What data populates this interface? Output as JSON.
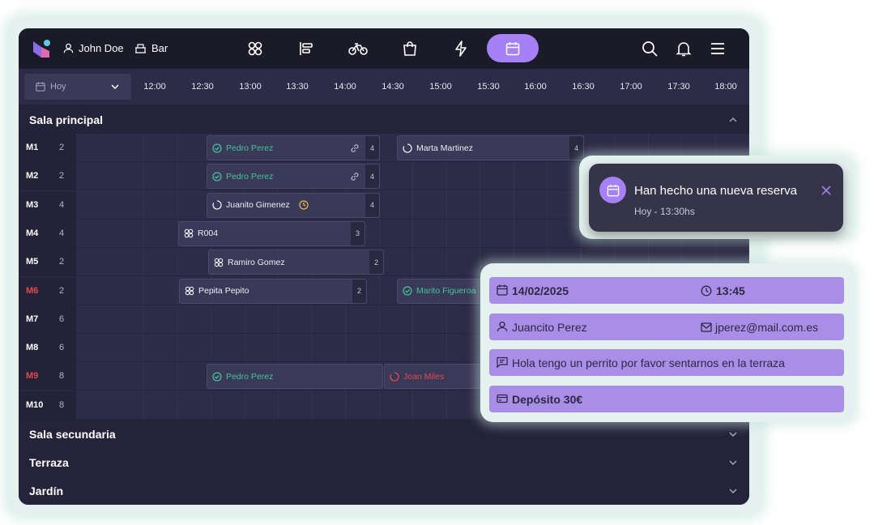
{
  "topbar": {
    "user_name": "John Doe",
    "venue_name": "Bar",
    "nav_icons": [
      "grid-icon",
      "floor-layout-icon",
      "bike-icon",
      "bag-icon",
      "lightning-icon",
      "calendar-icon"
    ],
    "active_nav": "calendar-icon",
    "right_icons": [
      "search-icon",
      "bell-icon",
      "menu-icon"
    ]
  },
  "timeline": {
    "date_selector": "Hoy",
    "times": [
      "12:00",
      "12:30",
      "13:00",
      "13:30",
      "14:00",
      "14:30",
      "15:00",
      "15:30",
      "16:00",
      "16:30",
      "17:00",
      "17:30",
      "18:00"
    ]
  },
  "sections": {
    "main": "Sala principal",
    "secondary": "Sala secundaria",
    "terrace": "Terraza",
    "garden": "Jardín"
  },
  "tables": [
    {
      "name": "M1",
      "capacity": "2",
      "alert": false
    },
    {
      "name": "M2",
      "capacity": "2",
      "alert": false
    },
    {
      "name": "M3",
      "capacity": "4",
      "alert": false
    },
    {
      "name": "M4",
      "capacity": "4",
      "alert": false
    },
    {
      "name": "M5",
      "capacity": "2",
      "alert": false
    },
    {
      "name": "M6",
      "capacity": "2",
      "alert": true
    },
    {
      "name": "M7",
      "capacity": "6",
      "alert": false
    },
    {
      "name": "M8",
      "capacity": "6",
      "alert": false
    },
    {
      "name": "M9",
      "capacity": "8",
      "alert": true
    },
    {
      "name": "M10",
      "capacity": "8",
      "alert": false
    }
  ],
  "reservations": [
    {
      "guest": "Pedro Perez",
      "count": "4",
      "status": "confirmed",
      "linked": true
    },
    {
      "guest": "Marta Martinez",
      "count": "4",
      "status": "pending"
    },
    {
      "guest": "Pedro Perez",
      "count": "4",
      "status": "confirmed",
      "linked": true
    },
    {
      "guest": "Juanito Gimenez",
      "count": "4",
      "status": "pending",
      "clock": true
    },
    {
      "guest": "R004",
      "count": "3",
      "status": "group"
    },
    {
      "guest": "Ramiro Gomez",
      "count": "2",
      "status": "group"
    },
    {
      "guest": "Pepita Pepito",
      "count": "2",
      "status": "group"
    },
    {
      "guest": "Marito Figueroa",
      "count": "",
      "status": "confirmed"
    },
    {
      "guest": "Pedro Perez",
      "count": "",
      "status": "confirmed"
    },
    {
      "guest": "Joan Miles",
      "count": "",
      "status": "cancelled"
    }
  ],
  "notification": {
    "title": "Han hecho una nueva reserva",
    "subtitle": "Hoy - 13:30hs"
  },
  "reservation_detail": {
    "date": "14/02/2025",
    "time": "13:45",
    "name": "Juancito Perez",
    "email": "jperez@mail.com.es",
    "message": "Hola tengo un perrito por favor sentarnos en la terraza",
    "deposit": "Depósito 30€"
  },
  "colors": {
    "accent": "#a680f5",
    "confirmed": "#43c29b",
    "alert": "#e5484d",
    "background": "#2d2b47"
  }
}
